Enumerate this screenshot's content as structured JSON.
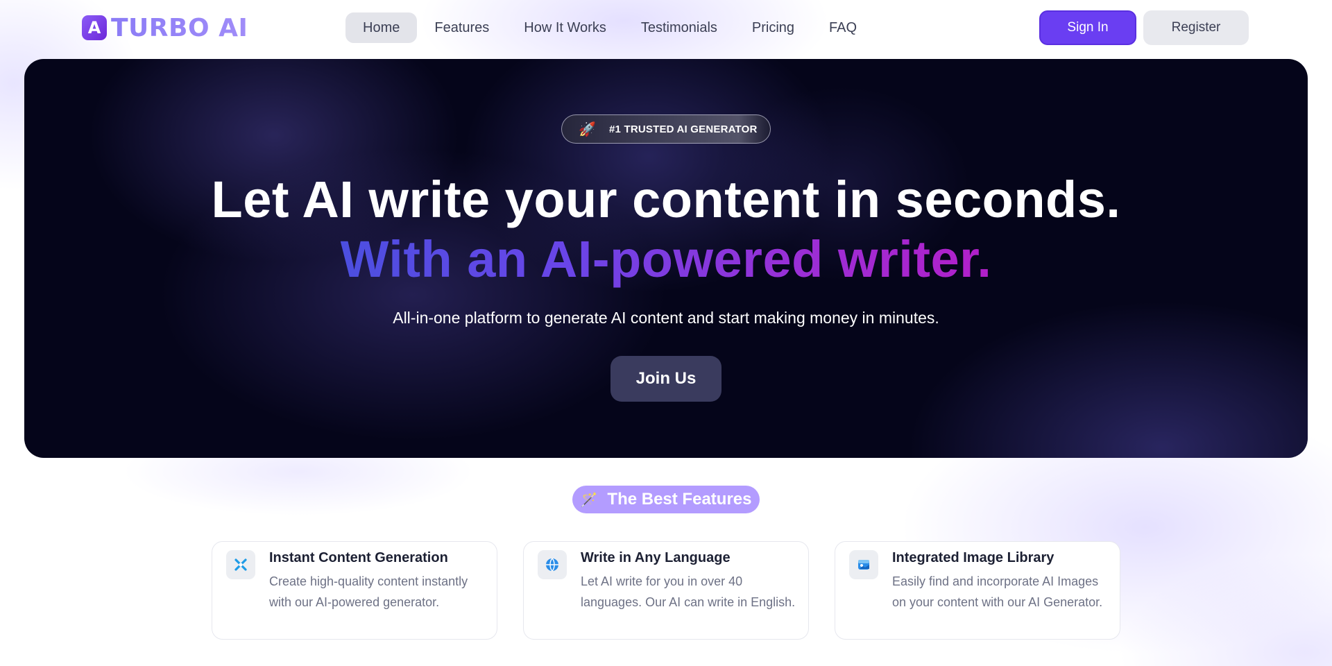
{
  "nav": {
    "logo_text": "TURBO AI",
    "logo_mark": "A",
    "links": [
      {
        "label": "Home",
        "active": true
      },
      {
        "label": "Features",
        "active": false
      },
      {
        "label": "How It Works",
        "active": false
      },
      {
        "label": "Testimonials",
        "active": false
      },
      {
        "label": "Pricing",
        "active": false
      },
      {
        "label": "FAQ",
        "active": false
      }
    ],
    "sign_in": "Sign In",
    "register": "Register"
  },
  "hero": {
    "badge_icon": "rocket-icon",
    "badge_text": "#1 TRUSTED AI GENERATOR",
    "headline": "Let AI write your content in seconds.",
    "headline_accent": "With an AI-powered writer.",
    "subtitle": "All-in-one platform to generate AI content and start making money in minutes.",
    "cta": "Join Us"
  },
  "features": {
    "pill_icon": "magic-wand-icon",
    "pill_label": "The Best Features",
    "cards": [
      {
        "icon": "sparkle-icon",
        "title": "Instant Content Generation",
        "description": "Create high-quality content instantly with our AI-powered generator."
      },
      {
        "icon": "globe-icon",
        "title": "Write in Any Language",
        "description": "Let AI write for you in over 40 languages. Our AI can write in English."
      },
      {
        "icon": "image-library-icon",
        "title": "Integrated Image Library",
        "description": "Easily find and incorporate AI Images on your content with our AI Generator."
      }
    ]
  },
  "colors": {
    "brand": "#6a3ef2",
    "hero_bg": "#05051a",
    "accent_gradient_start": "#4c4fe0",
    "accent_gradient_end": "#b21fc9",
    "pill_bg": "#b39cff"
  }
}
